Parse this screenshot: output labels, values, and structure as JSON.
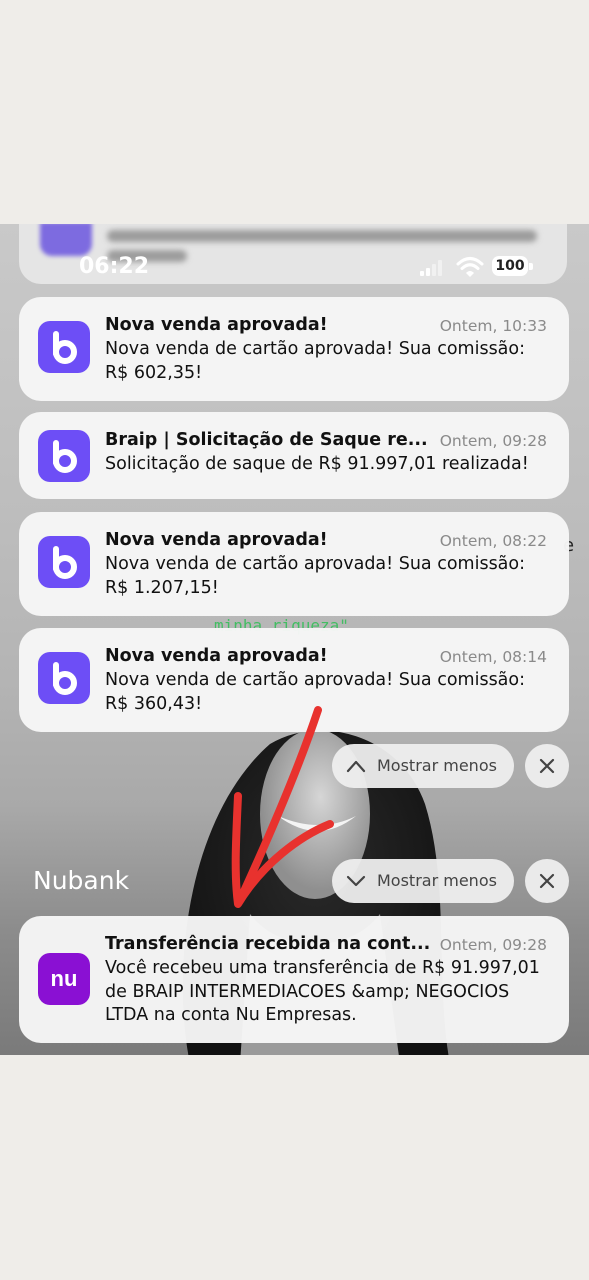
{
  "status_bar": {
    "time": "06:22",
    "battery": "100"
  },
  "background": {
    "caption": "minha riqueza\""
  },
  "braip_notifications": [
    {
      "title": "Nova venda aprovada!",
      "time": "Ontem, 10:33",
      "body": "Nova venda de cartão aprovada! Sua comissão: R$ 602,35!"
    },
    {
      "title": "Braip | Solicitação de Saque re...",
      "time": "Ontem, 09:28",
      "body": "Solicitação de saque de R$ 91.997,01 realizada!"
    },
    {
      "title": "Nova venda aprovada!",
      "time": "Ontem, 08:22",
      "body": "Nova venda de cartão aprovada! Sua comissão: R$ 1.207,15!"
    },
    {
      "title": "Nova venda aprovada!",
      "time": "Ontem, 08:14",
      "body": "Nova venda de cartão aprovada! Sua comissão: R$ 360,43!"
    }
  ],
  "group_controls": {
    "show_less": "Mostrar menos"
  },
  "nubank": {
    "group_label": "Nubank",
    "icon_text": "nu",
    "notification": {
      "title": "Transferência recebida na cont...",
      "time": "Ontem, 09:28",
      "body": "Você recebeu uma transferência de R$ 91.997,01 de BRAIP INTERMEDIACOES &amp; NEGOCIOS LTDA na conta Nu Empresas."
    }
  },
  "colors": {
    "braip_icon": "#6d4ef6",
    "nubank_icon": "#8a10d3",
    "annotation_arrow": "#e8322e"
  },
  "icons": {
    "braip": "braip-b-logo-icon",
    "nubank": "nubank-logo-icon",
    "collapse": "chevron-up-icon",
    "expand": "chevron-down-icon",
    "close": "close-icon"
  }
}
